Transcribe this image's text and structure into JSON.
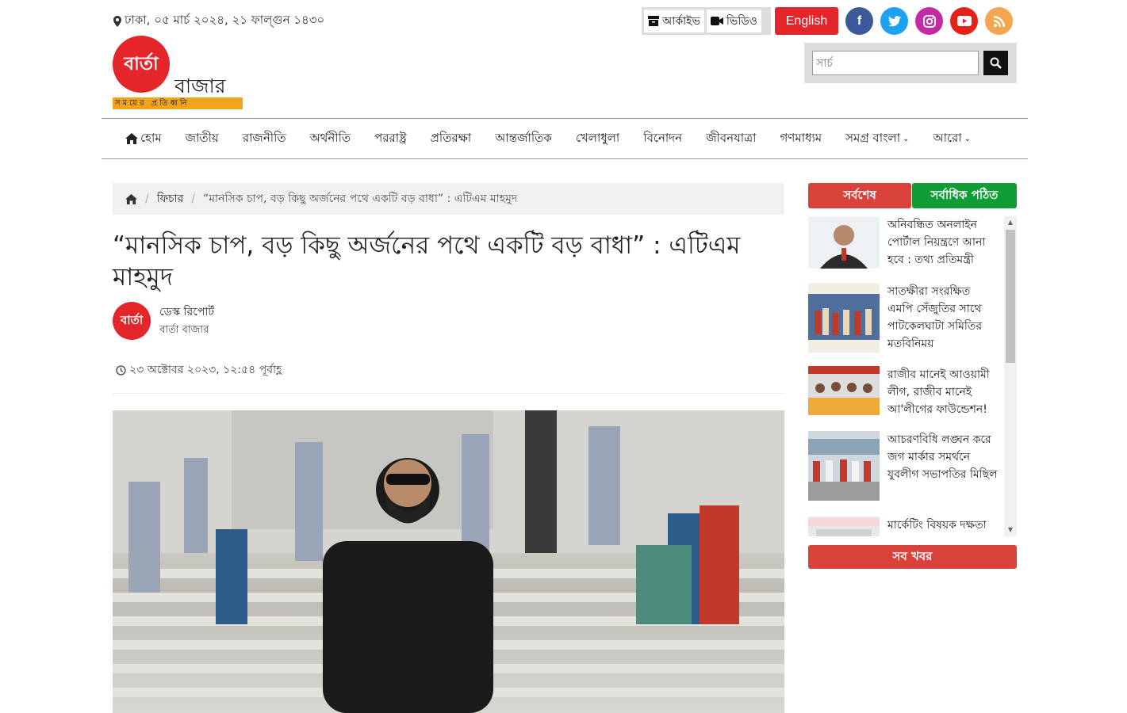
{
  "header": {
    "date_text": "ঢাকা, ০৫ মার্চ ২০২৪, ২১ ফাল্গুন ১৪৩০",
    "archive_label": "আর্কাইভ",
    "video_label": "ভিডিও",
    "english_label": "English",
    "search_placeholder": "সার্চ",
    "social": [
      {
        "name": "facebook",
        "color": "#3b5998",
        "glyph": "f"
      },
      {
        "name": "twitter",
        "color": "#1da1f2",
        "glyph": "t"
      },
      {
        "name": "instagram",
        "color": "#c32aa3",
        "glyph": "◎"
      },
      {
        "name": "youtube",
        "color": "#e62117",
        "glyph": "▶"
      },
      {
        "name": "rss",
        "color": "#f4a550",
        "glyph": ")"
      }
    ]
  },
  "logo": {
    "circle_text": "বার্তা",
    "word": "বাজার",
    "tagline": "সময়ের প্রতিধ্বনি"
  },
  "nav": {
    "items": [
      "হোম",
      "জাতীয়",
      "রাজনীতি",
      "অর্থনীতি",
      "পররাষ্ট্র",
      "প্রতিরক্ষা",
      "আন্তর্জাতিক",
      "খেলাধুলা",
      "বিনোদন",
      "জীবনযাত্রা",
      "গণমাধ্যম",
      "সমগ্র বাংলা",
      "আরো"
    ]
  },
  "breadcrumb": {
    "section": "ফিচার",
    "current": "“মানসিক চাপ, বড় কিছু অর্জনের পথে একটি বড় বাধা” : এটিএম মাহমুদ"
  },
  "article": {
    "headline": "“মানসিক চাপ, বড় কিছু অর্জনের পথে একটি বড় বাধা” : এটিএম মাহমুদ",
    "author_logo_text": "বার্তা",
    "author": "ডেস্ক রিপোর্ট",
    "author_org": "বার্তা বাজার",
    "published": "২৩ অক্টোবর ২০২৩, ১২:৫৪ পূর্বাহ্ণ"
  },
  "sidebar": {
    "tab_latest": "সর্বশেষ",
    "tab_popular": "সর্বাধিক পঠিত",
    "all_news": "সব খবর",
    "items": [
      {
        "title": "অনিবন্ধিত অনলাইন পোর্টাল নিয়ন্ত্রণে আনা হবে : তথ্য প্রতিমন্ত্রী"
      },
      {
        "title": "সাতক্ষীরা সংরক্ষিত এমপি সেঁজুতির সাথে পাটকেলঘাটা সমিতির মতবিনিময়"
      },
      {
        "title": "রাজীব মানেই আওয়ামী লীগ, রাজীব মানেই আ'লীগের ফাউন্ডেশন!"
      },
      {
        "title": "আচরণবিধি লঙ্ঘন করে জগ মার্কার সমর্থনে যুবলীগ সভাপতির মিছিল"
      },
      {
        "title": "মার্কেটিং বিষয়ক দক্ষতা"
      }
    ]
  }
}
